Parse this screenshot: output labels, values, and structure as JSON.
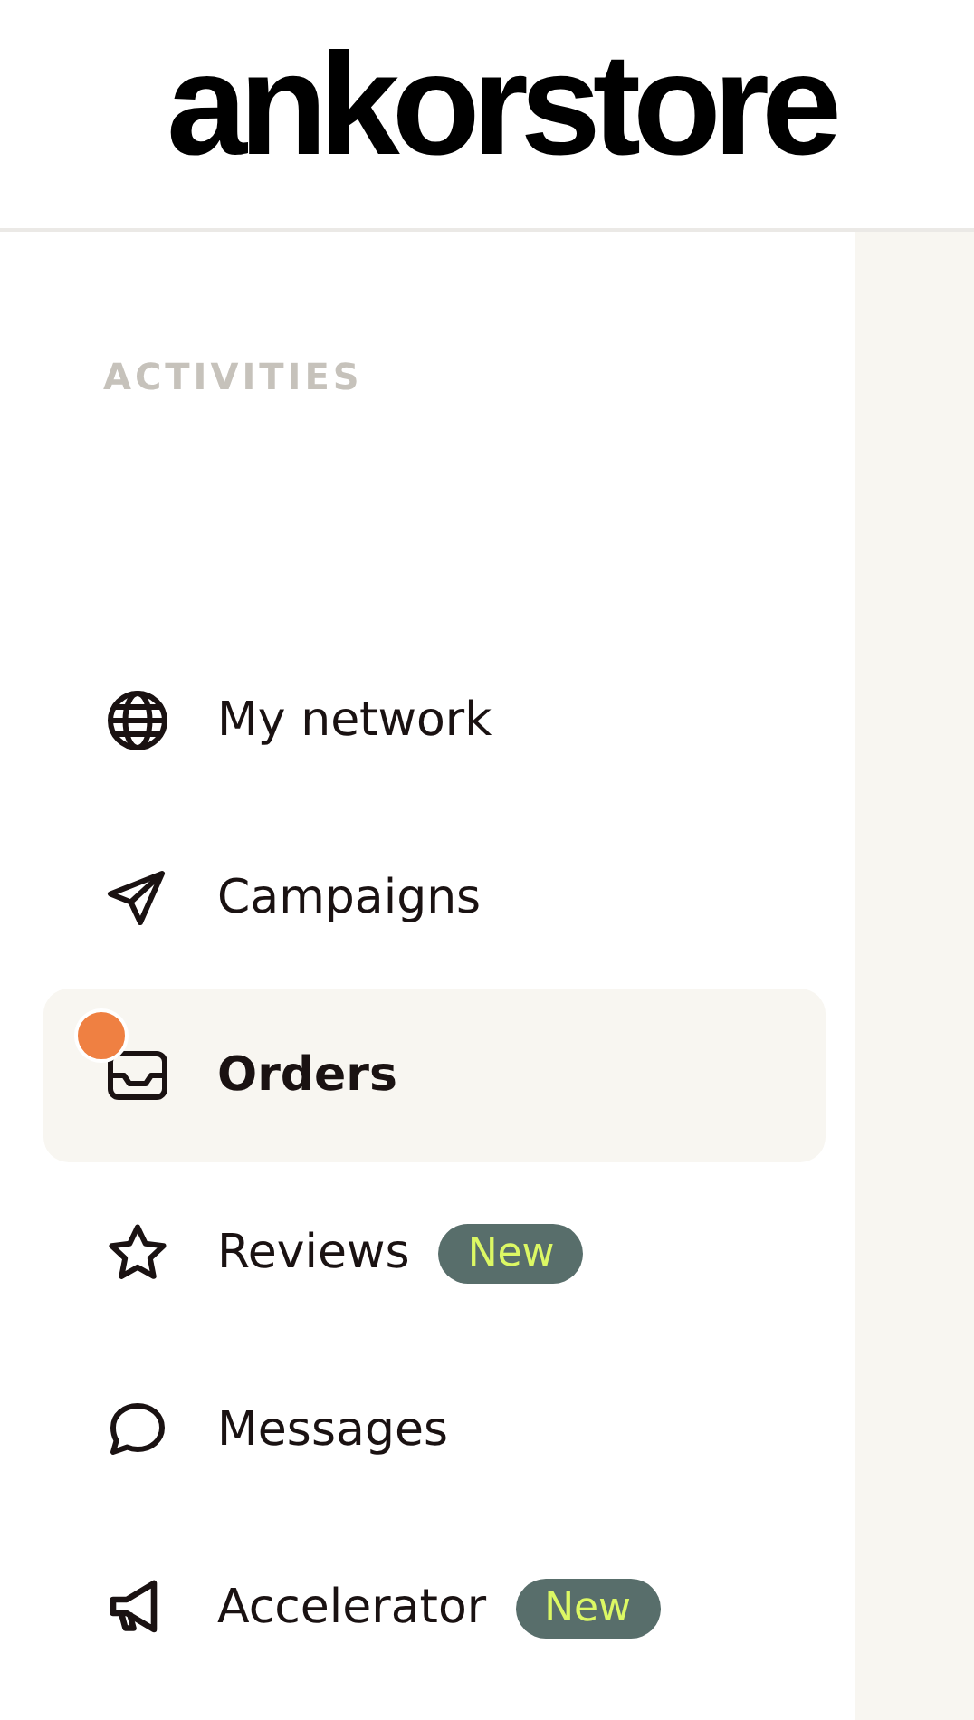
{
  "header": {
    "logo": "ankorstore"
  },
  "sidebar": {
    "section_title": "ACTIVITIES",
    "items": [
      {
        "label": "My network",
        "selected": false,
        "notification": false
      },
      {
        "label": "Campaigns",
        "selected": false,
        "notification": false
      },
      {
        "label": "Orders",
        "selected": true,
        "notification": true
      },
      {
        "label": "Reviews",
        "selected": false,
        "notification": false,
        "badge": "New"
      },
      {
        "label": "Messages",
        "selected": false,
        "notification": false
      },
      {
        "label": "Accelerator",
        "selected": false,
        "notification": false,
        "badge": "New"
      }
    ]
  }
}
